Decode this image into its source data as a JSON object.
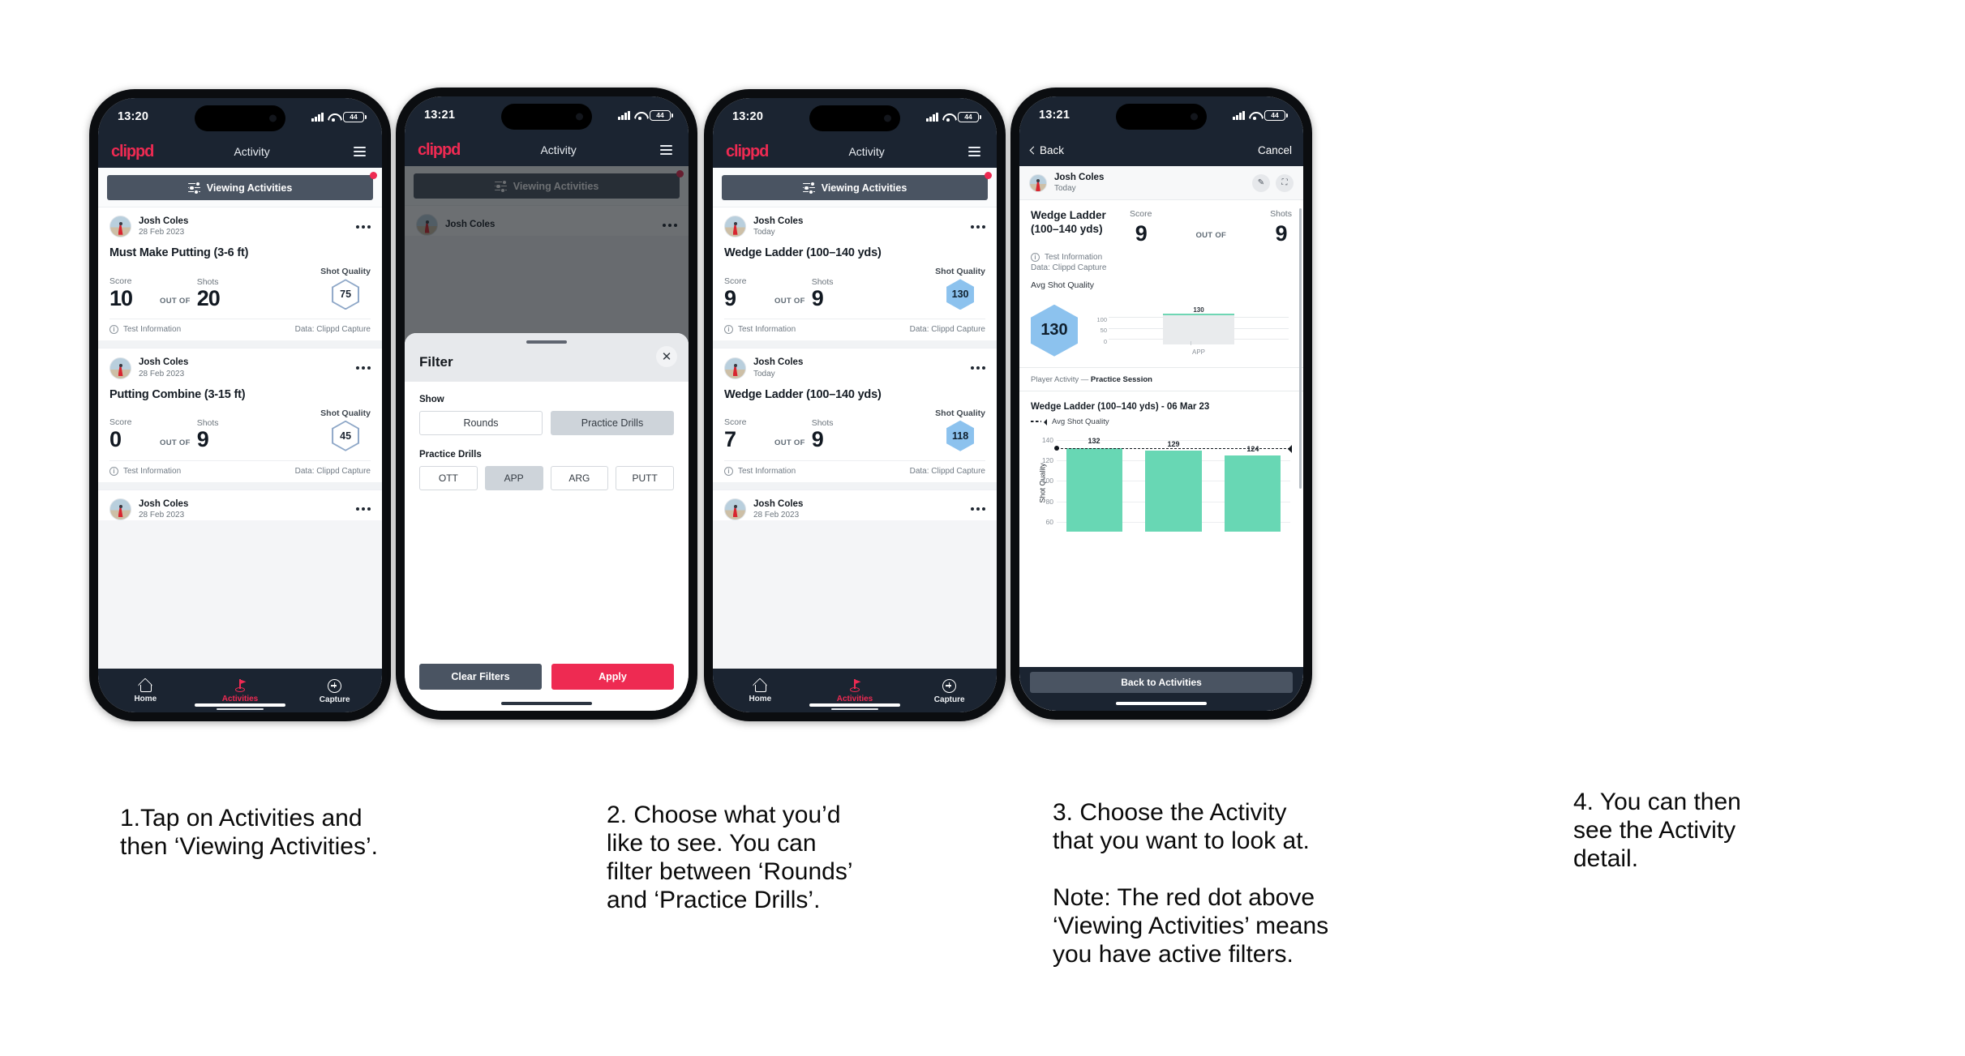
{
  "phones": [
    {
      "id": "phone-activities-list",
      "status": {
        "time": "13:20",
        "battery": "44"
      },
      "header": {
        "logo": "clippd",
        "title": "Activity"
      },
      "filter_bar": {
        "label": "Viewing Activities",
        "has_red_dot": true
      },
      "cards": [
        {
          "user": "Josh Coles",
          "date": "28 Feb 2023",
          "title": "Must Make Putting (3-6 ft)",
          "score_label": "Score",
          "shots_label": "Shots",
          "quality_label": "Shot Quality",
          "score": "10",
          "out_of": "OUT OF",
          "shots": "20",
          "quality": "75",
          "quality_style": "outline",
          "test_info": "Test Information",
          "data_source": "Data: Clippd Capture"
        },
        {
          "user": "Josh Coles",
          "date": "28 Feb 2023",
          "title": "Putting Combine (3-15 ft)",
          "score_label": "Score",
          "shots_label": "Shots",
          "quality_label": "Shot Quality",
          "score": "0",
          "out_of": "OUT OF",
          "shots": "9",
          "quality": "45",
          "quality_style": "outline",
          "test_info": "Test Information",
          "data_source": "Data: Clippd Capture"
        }
      ],
      "partial_card": {
        "user": "Josh Coles",
        "date": "28 Feb 2023"
      },
      "tabs": [
        {
          "label": "Home",
          "icon": "home-icon",
          "active": false
        },
        {
          "label": "Activities",
          "icon": "golf-flag-icon",
          "active": true
        },
        {
          "label": "Capture",
          "icon": "plus-circle-icon",
          "active": false
        }
      ]
    },
    {
      "id": "phone-filter-sheet",
      "status": {
        "time": "13:21",
        "battery": "44"
      },
      "header": {
        "logo": "clippd",
        "title": "Activity"
      },
      "filter_bar": {
        "label": "Viewing Activities",
        "has_red_dot": true
      },
      "behind_card": {
        "user": "Josh Coles"
      },
      "sheet": {
        "title": "Filter",
        "close_icon": "close-icon",
        "show_label": "Show",
        "show_options": [
          {
            "label": "Rounds",
            "selected": false
          },
          {
            "label": "Practice Drills",
            "selected": true
          }
        ],
        "drills_label": "Practice Drills",
        "drill_options": [
          {
            "label": "OTT",
            "selected": false
          },
          {
            "label": "APP",
            "selected": true
          },
          {
            "label": "ARG",
            "selected": false
          },
          {
            "label": "PUTT",
            "selected": false
          }
        ],
        "clear_label": "Clear Filters",
        "apply_label": "Apply"
      }
    },
    {
      "id": "phone-activities-filtered",
      "status": {
        "time": "13:20",
        "battery": "44"
      },
      "header": {
        "logo": "clippd",
        "title": "Activity"
      },
      "filter_bar": {
        "label": "Viewing Activities",
        "has_red_dot": true
      },
      "cards": [
        {
          "user": "Josh Coles",
          "date": "Today",
          "title": "Wedge Ladder (100–140 yds)",
          "score_label": "Score",
          "shots_label": "Shots",
          "quality_label": "Shot Quality",
          "score": "9",
          "out_of": "OUT OF",
          "shots": "9",
          "quality": "130",
          "quality_style": "filled",
          "test_info": "Test Information",
          "data_source": "Data: Clippd Capture"
        },
        {
          "user": "Josh Coles",
          "date": "Today",
          "title": "Wedge Ladder (100–140 yds)",
          "score_label": "Score",
          "shots_label": "Shots",
          "quality_label": "Shot Quality",
          "score": "7",
          "out_of": "OUT OF",
          "shots": "9",
          "quality": "118",
          "quality_style": "filled",
          "test_info": "Test Information",
          "data_source": "Data: Clippd Capture"
        }
      ],
      "partial_card": {
        "user": "Josh Coles",
        "date": "28 Feb 2023"
      },
      "tabs": [
        {
          "label": "Home",
          "icon": "home-icon",
          "active": false
        },
        {
          "label": "Activities",
          "icon": "golf-flag-icon",
          "active": true
        },
        {
          "label": "Capture",
          "icon": "plus-circle-icon",
          "active": false
        }
      ]
    },
    {
      "id": "phone-activity-detail",
      "status": {
        "time": "13:21",
        "battery": "44"
      },
      "navbar": {
        "back": "Back",
        "cancel": "Cancel"
      },
      "detail": {
        "user": "Josh Coles",
        "date": "Today",
        "edit_icon": "pencil-icon",
        "expand_icon": "fullscreen-icon",
        "title": "Wedge Ladder (100–140 yds)",
        "score_label": "Score",
        "shots_label": "Shots",
        "score": "9",
        "out_of": "OUT OF",
        "shots": "9",
        "test_info": "Test Information",
        "data_source": "Data: Clippd Capture",
        "avg_label": "Avg Shot Quality",
        "avg_value": "130",
        "player_activity_prefix": "Player Activity — ",
        "player_activity_value": "Practice Session",
        "chart_title": "Wedge Ladder (100–140 yds) - 06 Mar 23",
        "legend_label": "Avg Shot Quality",
        "back_button": "Back to Activities"
      }
    }
  ],
  "chart_data": [
    {
      "type": "bar",
      "title": "Avg Shot Quality",
      "categories": [
        "APP"
      ],
      "values": [
        130
      ],
      "ylabel": "",
      "xlabel": "",
      "ytick_labels": [
        "100",
        "50",
        "0"
      ],
      "ytick_values": [
        100,
        50,
        0
      ],
      "ylim": [
        0,
        150
      ],
      "grid": true,
      "bar_color": "#e9ebed",
      "cap_color": "#6fd6b4",
      "data_labels": [
        "130"
      ]
    },
    {
      "type": "bar",
      "title": "Wedge Ladder (100–140 yds) - 06 Mar 23",
      "categories": [
        "",
        "",
        ""
      ],
      "values": [
        132,
        129,
        124
      ],
      "data_labels": [
        "132",
        "129",
        "124"
      ],
      "ylabel": "Shot Quality",
      "xlabel": "",
      "ytick_labels": [
        "140",
        "120",
        "100",
        "80",
        "60"
      ],
      "ytick_values": [
        140,
        120,
        100,
        80,
        60
      ],
      "ylim": [
        50,
        145
      ],
      "grid": true,
      "bar_color": "#68d7b4",
      "legend": [
        "Avg Shot Quality"
      ],
      "legend_position": "top-left",
      "annotations": [
        {
          "type": "avg-line",
          "label": "Avg Shot Quality",
          "value": 131,
          "style": "dashed"
        }
      ]
    }
  ],
  "captions": [
    "1.Tap on Activities and\nthen ‘Viewing Activities’.",
    "2. Choose what you’d\nlike to see. You can\nfilter between ‘Rounds’\nand ‘Practice Drills’.",
    "3. Choose the Activity\nthat you want to look at.\n\nNote: The red dot above\n‘Viewing Activities’ means\nyou have active filters.",
    "4. You can then\nsee the Activity\ndetail."
  ],
  "colors": {
    "brand_red": "#ee2a52",
    "dark_navy": "#1b2431",
    "slate": "#4a5462",
    "hex_blue": "#8cc2ee",
    "bar_green": "#68d7b4"
  }
}
